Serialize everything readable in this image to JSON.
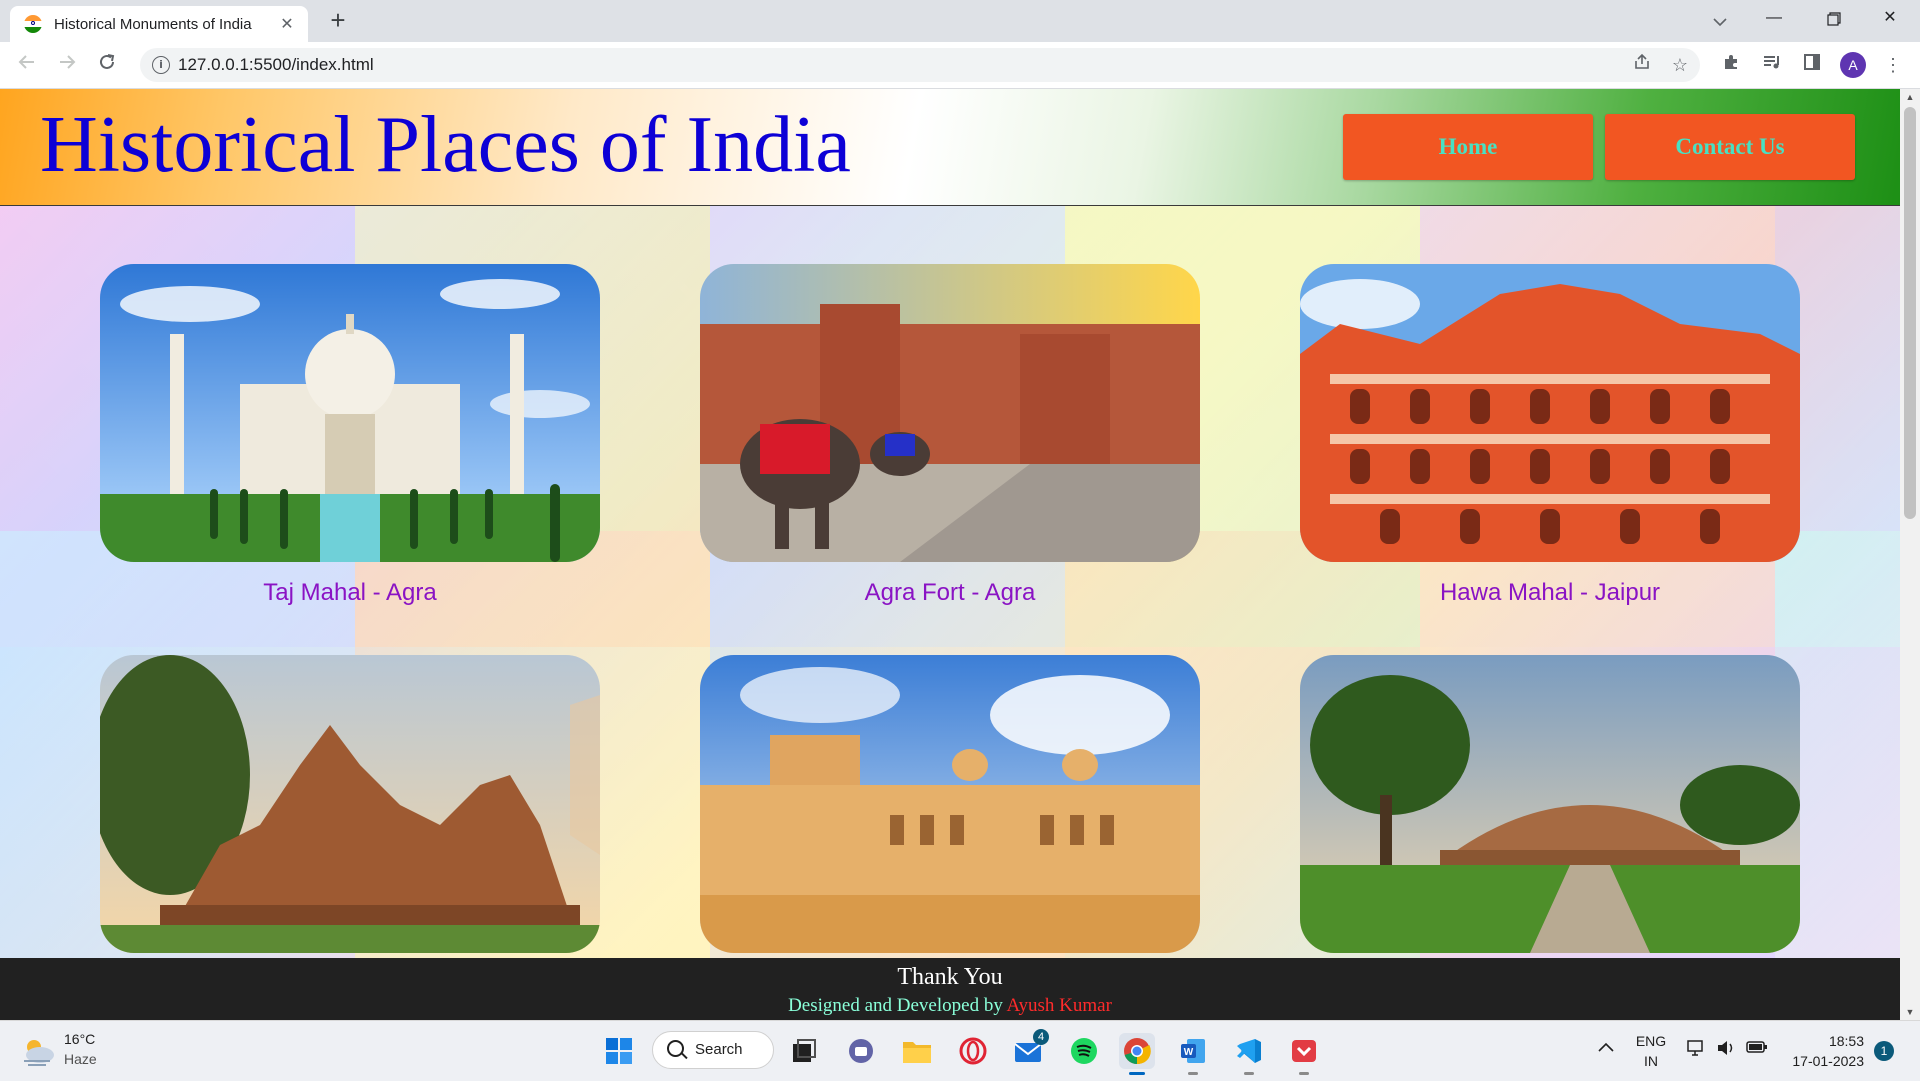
{
  "browser": {
    "tab_title": "Historical Monuments of India",
    "url": "127.0.0.1:5500/index.html",
    "profile_initial": "A"
  },
  "site": {
    "title": "Historical Places of India",
    "nav": [
      "Home",
      "Contact Us"
    ],
    "cards": [
      {
        "caption": "Taj Mahal - Agra",
        "scene": "taj"
      },
      {
        "caption": "Agra Fort - Agra",
        "scene": "fort"
      },
      {
        "caption": "Hawa Mahal - Jaipur",
        "scene": "hawa"
      },
      {
        "caption": "",
        "scene": "temple"
      },
      {
        "caption": "",
        "scene": "amber"
      },
      {
        "caption": "",
        "scene": "stupa"
      }
    ],
    "footer": {
      "thanks": "Thank You",
      "credit_prefix": "Designed and Developed by",
      "author": "Ayush Kumar"
    }
  },
  "taskbar": {
    "weather": {
      "temp": "16°C",
      "condition": "Haze"
    },
    "search_label": "Search",
    "mail_badge": "4",
    "language": [
      "ENG",
      "IN"
    ],
    "time": "18:53",
    "date": "17-01-2023",
    "notifications": "1"
  }
}
